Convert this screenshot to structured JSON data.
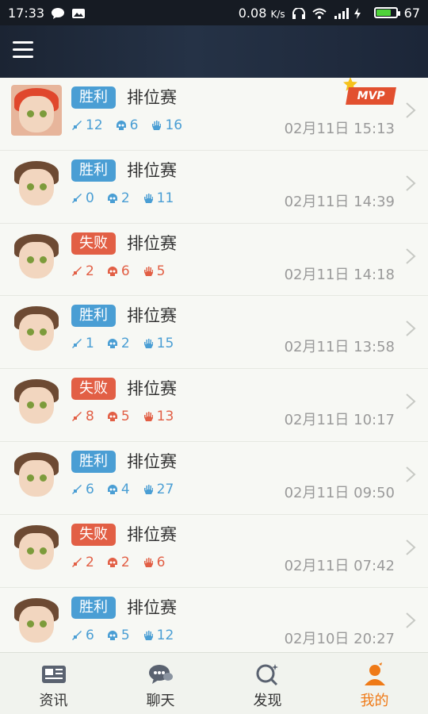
{
  "statusbar": {
    "time": "17:33",
    "speed": "0.08",
    "speed_unit": "K/s",
    "battery": "67",
    "network": "4G"
  },
  "mvp_label": "MVP",
  "matches": [
    {
      "result": "胜利",
      "mode": "排位赛",
      "kills": "12",
      "deaths": "6",
      "assists": "16",
      "time": "02月11日 15:13",
      "win": true,
      "mvp": true
    },
    {
      "result": "胜利",
      "mode": "排位赛",
      "kills": "0",
      "deaths": "2",
      "assists": "11",
      "time": "02月11日 14:39",
      "win": true
    },
    {
      "result": "失败",
      "mode": "排位赛",
      "kills": "2",
      "deaths": "6",
      "assists": "5",
      "time": "02月11日 14:18",
      "win": false
    },
    {
      "result": "胜利",
      "mode": "排位赛",
      "kills": "1",
      "deaths": "2",
      "assists": "15",
      "time": "02月11日 13:58",
      "win": true
    },
    {
      "result": "失败",
      "mode": "排位赛",
      "kills": "8",
      "deaths": "5",
      "assists": "13",
      "time": "02月11日 10:17",
      "win": false
    },
    {
      "result": "胜利",
      "mode": "排位赛",
      "kills": "6",
      "deaths": "4",
      "assists": "27",
      "time": "02月11日 09:50",
      "win": true
    },
    {
      "result": "失败",
      "mode": "排位赛",
      "kills": "2",
      "deaths": "2",
      "assists": "6",
      "time": "02月11日 07:42",
      "win": false
    },
    {
      "result": "胜利",
      "mode": "排位赛",
      "kills": "6",
      "deaths": "5",
      "assists": "12",
      "time": "02月10日 20:27",
      "win": true
    }
  ],
  "tabs": [
    {
      "label": "资讯",
      "icon": "news-icon"
    },
    {
      "label": "聊天",
      "icon": "chat-icon"
    },
    {
      "label": "发现",
      "icon": "discover-icon"
    },
    {
      "label": "我的",
      "icon": "profile-icon",
      "active": true
    }
  ],
  "colors": {
    "win": "#4a9ed4",
    "lose": "#e25f45",
    "active_tab": "#ef7a17"
  }
}
